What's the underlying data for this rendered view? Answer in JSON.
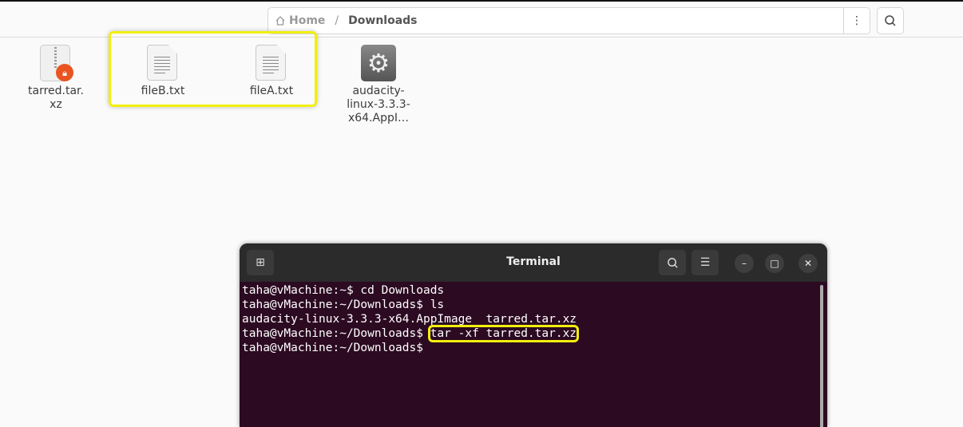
{
  "pathbar": {
    "home": "Home",
    "separator": "/",
    "current": "Downloads"
  },
  "files": [
    {
      "name": "tarred.tar.\nxz",
      "icon": "archive-locked-icon"
    },
    {
      "name": "fileB.txt",
      "icon": "text-file-icon"
    },
    {
      "name": "fileA.txt",
      "icon": "text-file-icon"
    },
    {
      "name": "audacity-linux-3.3.3-x64.AppI…",
      "line1": "audacity-",
      "line2": "linux-3.3.3-",
      "line3": "x64.AppI…",
      "icon": "executable-icon"
    }
  ],
  "terminal": {
    "title": "Terminal",
    "lines": [
      "taha@vMachine:~$ cd Downloads",
      "taha@vMachine:~/Downloads$ ls",
      "audacity-linux-3.3.3-x64.AppImage  tarred.tar.xz"
    ],
    "prompt": "taha@vMachine:~/Downloads$ ",
    "highlighted_command": "tar -xf tarred.tar.xz",
    "last_prompt": "taha@vMachine:~/Downloads$"
  },
  "colors": {
    "highlight": "#f2ef0d",
    "terminal_bg": "#2c0a22",
    "lock_badge": "#e95420"
  }
}
